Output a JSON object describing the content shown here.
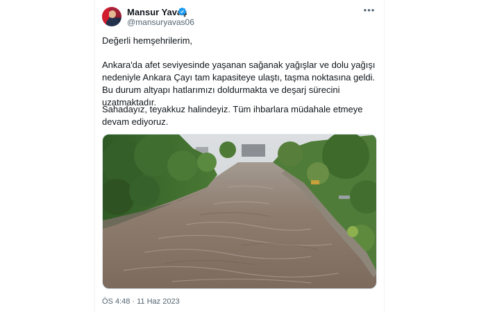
{
  "tweet": {
    "author_name": "Mansur Yavaş",
    "author_handle": "@mansuryavas06",
    "verified": true,
    "more_icon": "more-horizontal-icon",
    "paragraphs": [
      "Değerli hemşehrilerim,",
      "Ankara'da afet seviyesinde yaşanan sağanak yağışlar ve dolu yağışı nedeniyle Ankara Çayı tam kapasiteye ulaştı, taşma noktasına geldi. Bu durum altyapı hatlarımızı doldurmakta ve deşarj sürecini uzatmaktadır.",
      "Sahadayız, teyakkuz halindeyiz. Tüm ihbarlara müdahale etmeye devam ediyoruz."
    ],
    "timestamp": "ÖS 4:48 · 11 Haz 2023"
  },
  "colors": {
    "text_primary": "#0f1419",
    "text_secondary": "#536471",
    "verified_blue": "#1d9bf0",
    "river_brown": "#8a7767"
  }
}
